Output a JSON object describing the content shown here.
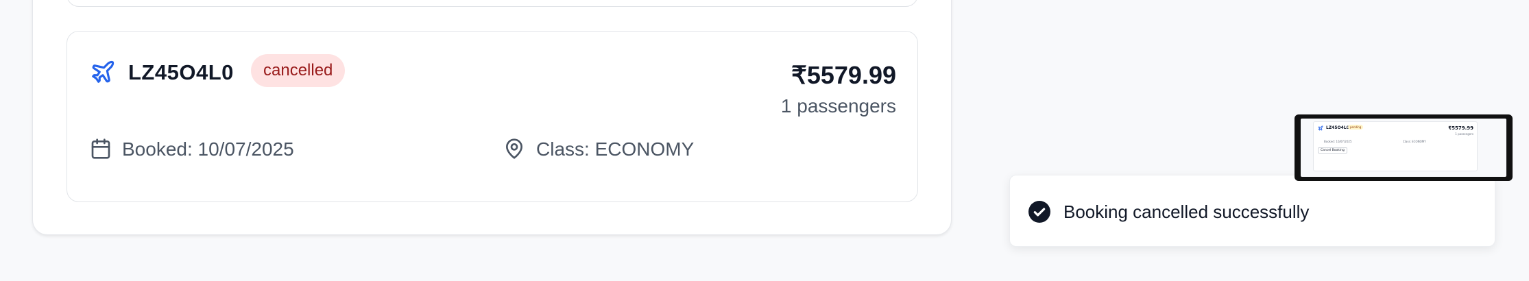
{
  "booking": {
    "reference": "LZ45O4L0",
    "status": "cancelled",
    "price": "₹5579.99",
    "passengers": "1 passengers",
    "booked_date": "Booked: 10/07/2025",
    "class_label": "Class: ECONOMY",
    "icon": "plane-icon"
  },
  "toast": {
    "message": "Booking cancelled successfully",
    "icon": "check-circle-icon"
  },
  "thumbnail": {
    "reference": "LZ45O4L0",
    "status": "pending",
    "price": "₹5579.99",
    "passengers": "1 passengers",
    "booked_date": "Booked: 10/07/2025",
    "class_label": "Class: ECONOMY",
    "cancel_label": "Cancel Booking"
  },
  "colors": {
    "accent": "#2563eb",
    "badge_bg": "#fee2e2",
    "badge_text": "#991b1b"
  }
}
